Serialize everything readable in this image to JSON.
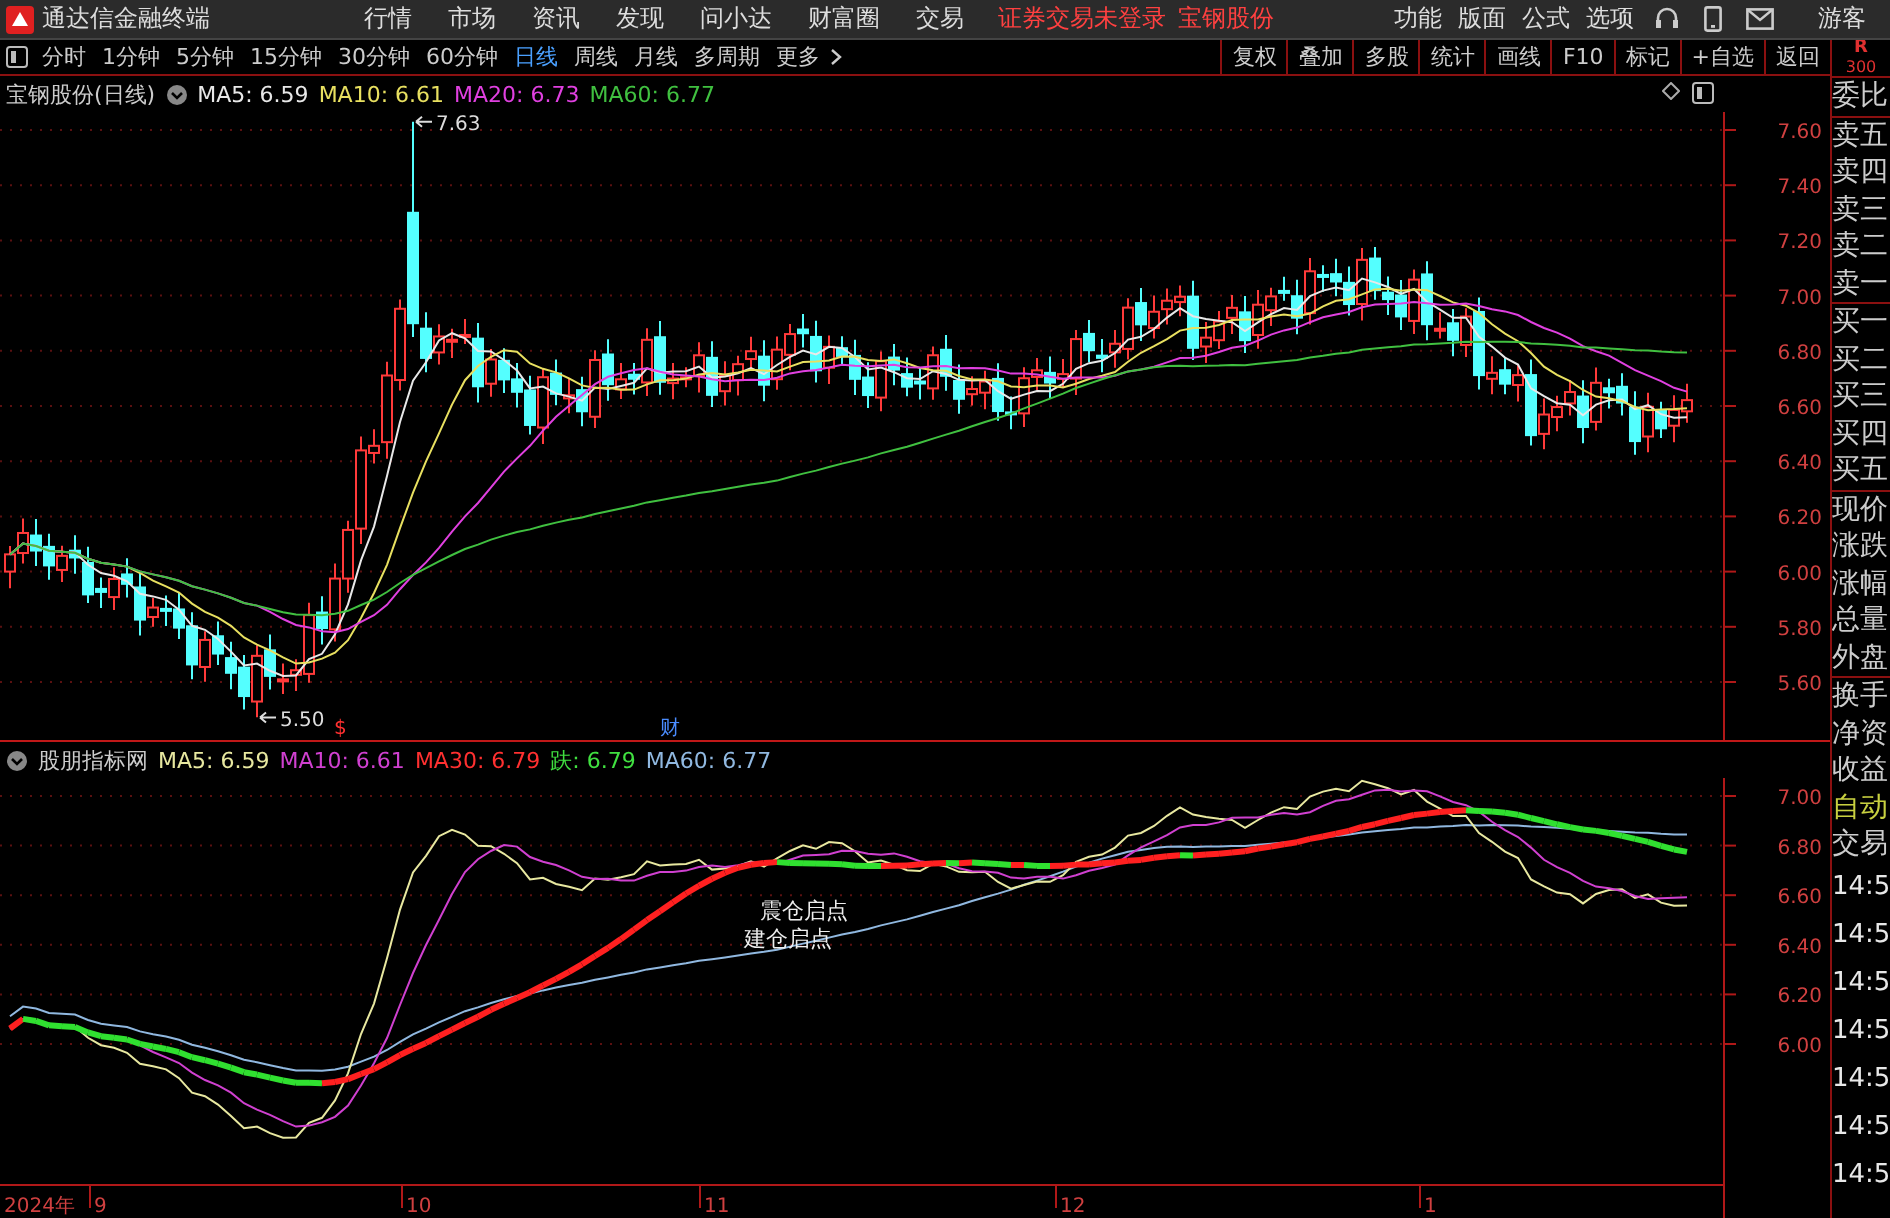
{
  "menu_bar": {
    "app_title": "通达信金融终端",
    "menus": [
      "行情",
      "市场",
      "资讯",
      "发现",
      "问小达",
      "财富圈",
      "交易"
    ],
    "notice": "证券交易未登录",
    "stock": "宝钢股份",
    "tools": [
      "功能",
      "版面",
      "公式",
      "选项"
    ],
    "user": "游客"
  },
  "toolbar": {
    "periods": [
      {
        "label": "分时",
        "selected": false
      },
      {
        "label": "1分钟",
        "selected": false
      },
      {
        "label": "5分钟",
        "selected": false
      },
      {
        "label": "15分钟",
        "selected": false
      },
      {
        "label": "30分钟",
        "selected": false
      },
      {
        "label": "60分钟",
        "selected": false
      },
      {
        "label": "日线",
        "selected": true
      },
      {
        "label": "周线",
        "selected": false
      },
      {
        "label": "月线",
        "selected": false
      },
      {
        "label": "多周期",
        "selected": false
      }
    ],
    "more": "更多",
    "actions": [
      "复权",
      "叠加",
      "多股",
      "统计",
      "画线",
      "F10",
      "标记",
      "+自选",
      "返回"
    ]
  },
  "main_chart": {
    "stock_label": "宝钢股份(日线)",
    "legend": [
      {
        "label": "MA5: 6.59",
        "color": "#e8e8e8"
      },
      {
        "label": "MA10: 6.61",
        "color": "#e8e060"
      },
      {
        "label": "MA20: 6.73",
        "color": "#e040e0"
      },
      {
        "label": "MA60: 6.77",
        "color": "#40c040"
      }
    ],
    "price_ticks": [
      "7.60",
      "7.40",
      "7.20",
      "7.00",
      "6.80",
      "6.60",
      "6.40",
      "6.20",
      "6.00",
      "5.80",
      "5.60"
    ],
    "high_label": "7.63",
    "low_label": "5.50",
    "markers": [
      {
        "text": "$",
        "color": "#ff3030"
      },
      {
        "text": "财",
        "color": "#4a8cff"
      }
    ]
  },
  "indicator": {
    "name": "股朋指标网",
    "legend": [
      {
        "label": "MA5: 6.59",
        "color": "#e8e8a0"
      },
      {
        "label": "MA10: 6.61",
        "color": "#d040d0"
      },
      {
        "label": "MA30: 6.79",
        "color": "#ff3030"
      },
      {
        "label": "趺: 6.79",
        "color": "#40e040"
      },
      {
        "label": "MA60: 6.77",
        "color": "#90b8e0"
      }
    ],
    "price_ticks": [
      "7.00",
      "6.80",
      "6.60",
      "6.40",
      "6.20",
      "6.00"
    ],
    "annotations": [
      "震仓启点",
      "建仓启点"
    ]
  },
  "time_axis": [
    "2024年",
    "9",
    "10",
    "11",
    "12",
    "1"
  ],
  "side_panel": {
    "header": "R",
    "code": "300",
    "quote_labels": [
      "委比",
      "卖五",
      "卖四",
      "卖三",
      "卖二",
      "卖一",
      "买一",
      "买二",
      "买三",
      "买四",
      "买五",
      "现价",
      "涨跌",
      "涨幅",
      "总量",
      "外盘",
      "换手",
      "净资",
      "收益"
    ],
    "auto_trade": [
      "自动",
      "交易"
    ],
    "times": [
      "14:5",
      "14:5",
      "14:5",
      "14:5",
      "14:5",
      "14:5",
      "14:5"
    ]
  }
}
